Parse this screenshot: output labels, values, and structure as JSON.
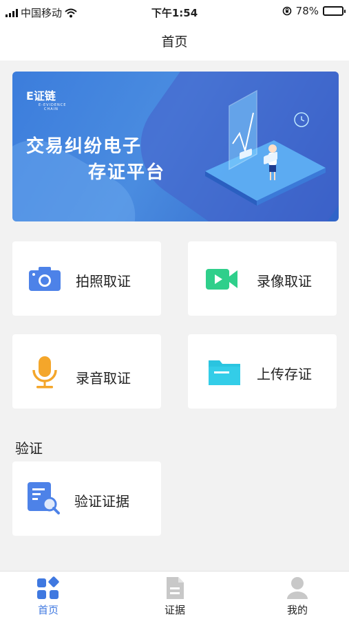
{
  "status_bar": {
    "carrier": "中国移动",
    "time": "下午1:54",
    "battery_percent": "78%",
    "battery_level": 0.78
  },
  "nav": {
    "title": "首页"
  },
  "banner": {
    "brand": "E证链",
    "brand_sub_1": "E-EVIDENCE",
    "brand_sub_2": "CHAIN",
    "line1": "交易纠纷电子",
    "line2": "存证平台"
  },
  "cards": {
    "photo": {
      "label": "拍照取证",
      "icon": "camera-icon",
      "color": "#4d82e8"
    },
    "video": {
      "label": "录像取证",
      "icon": "video-camera-icon",
      "color": "#2fcf8b"
    },
    "audio": {
      "label": "录音取证",
      "icon": "microphone-icon",
      "color": "#f4a62a"
    },
    "upload": {
      "label": "上传存证",
      "icon": "folder-icon",
      "color": "#2ac4e0"
    }
  },
  "verify_section": {
    "title": "验证",
    "card": {
      "label": "验证证据",
      "icon": "document-search-icon",
      "color": "#4d82e8"
    }
  },
  "tab_bar": {
    "tabs": [
      {
        "label": "首页",
        "icon": "grid-home-icon",
        "active": true
      },
      {
        "label": "证据",
        "icon": "document-icon",
        "active": false
      },
      {
        "label": "我的",
        "icon": "user-icon",
        "active": false
      }
    ],
    "active_color": "#3f78e0",
    "inactive_color": "#c8c8c8"
  }
}
